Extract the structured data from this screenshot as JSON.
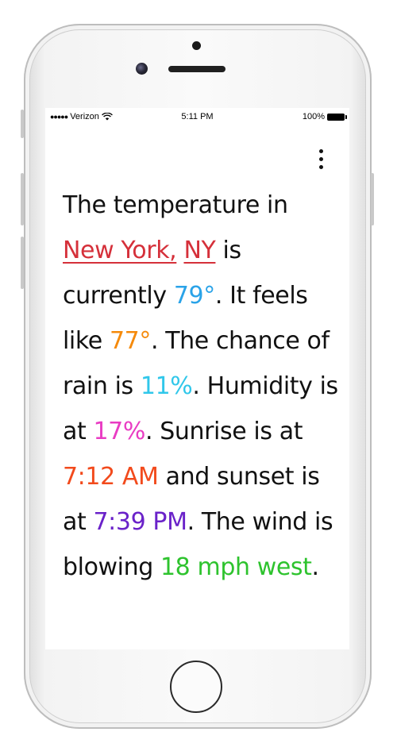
{
  "status_bar": {
    "signal": "●●●●●",
    "carrier": "Verizon",
    "time": "5:11 PM",
    "battery": "100%"
  },
  "forecast": {
    "intro": "The temperature in ",
    "city": "New York,",
    "state": "NY",
    "after_location": " is currently ",
    "temperature": "79°",
    "feels_like_prefix": ". It feels like ",
    "feels_like": "77°",
    "rain_prefix": ". The chance of rain is ",
    "rain": "11%",
    "humidity_prefix": ". Humidity is at ",
    "humidity": "17%",
    "sunrise_prefix": ". Sunrise is at ",
    "sunrise": "7:12 AM",
    "sunset_prefix": " and sunset is at ",
    "sunset": "7:39 PM",
    "wind_prefix": ". The wind is blowing ",
    "wind": "18 mph west",
    "end": "."
  },
  "colors": {
    "location": "#d5303a",
    "temperature": "#2aa3e8",
    "feels_like": "#f58a0b",
    "rain": "#30c7ea",
    "humidity": "#e93cc3",
    "sunrise": "#f24a1c",
    "sunset": "#6a22c9",
    "wind": "#2ec32e"
  },
  "icons": {
    "menu": "more-vertical-icon",
    "wifi": "wifi-icon",
    "battery": "battery-icon"
  }
}
